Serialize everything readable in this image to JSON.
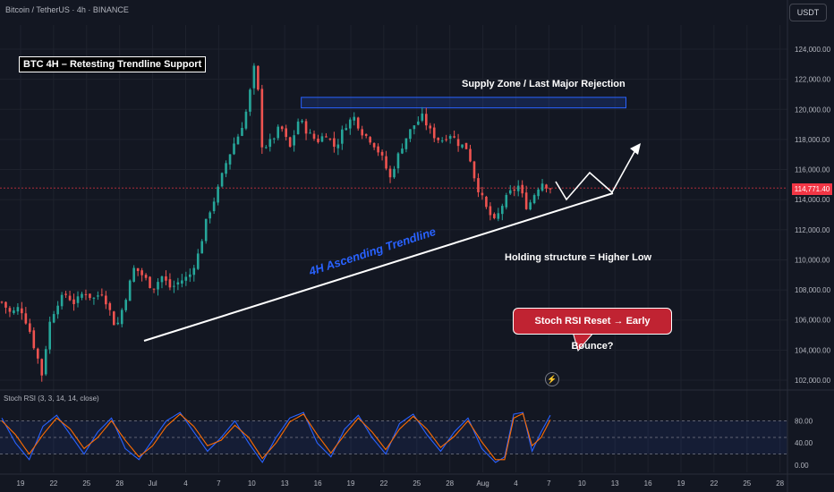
{
  "header": {
    "symbol": "Bitcoin / TetherUS · 4h · BINANCE",
    "currency": "USDT"
  },
  "annotations": {
    "title": "BTC 4H – Retesting Trendline Support",
    "supply_zone": "Supply Zone / Last Major Rejection",
    "trendline": "4H Ascending Trendline",
    "structure": "Holding structure = Higher Low",
    "callout": "Stoch RSI Reset → Early Bounce?"
  },
  "indicator": {
    "label": "Stoch RSI (3, 3, 14, 14, close)"
  },
  "icons": {
    "bolt": "lightning-icon"
  },
  "colors": {
    "background": "#131722",
    "up": "#26a69a",
    "down": "#ef5350",
    "k_line": "#2962ff",
    "d_line": "#ff6d00",
    "zone": "#2962ff",
    "price_line": "#f23645"
  },
  "chart_data": [
    {
      "type": "candlestick",
      "price_axis": {
        "ylim": [
          101000,
          125000
        ],
        "ticks": [
          "124,000.00",
          "122,000.00",
          "120,000.00",
          "118,000.00",
          "116,000.00",
          "114,000.00",
          "112,000.00",
          "110,000.00",
          "108,000.00",
          "106,000.00",
          "104,000.00",
          "102,000.00"
        ]
      },
      "last_price": "114,771.40",
      "last_price_value": 114771.4,
      "x_ticks": [
        "19",
        "22",
        "25",
        "28",
        "Jul",
        "4",
        "7",
        "10",
        "13",
        "16",
        "19",
        "22",
        "25",
        "28",
        "Aug",
        "4",
        "7",
        "10",
        "13",
        "16",
        "19",
        "22",
        "25",
        "28"
      ],
      "anchor_points": [
        [
          0,
          107200
        ],
        [
          2,
          106400
        ],
        [
          4,
          106900
        ],
        [
          6,
          105400
        ],
        [
          7,
          104300
        ],
        [
          8,
          103300
        ],
        [
          9,
          102100
        ],
        [
          10,
          105400
        ],
        [
          12,
          107100
        ],
        [
          14,
          107700
        ],
        [
          16,
          107100
        ],
        [
          18,
          107900
        ],
        [
          20,
          107400
        ],
        [
          22,
          107900
        ],
        [
          24,
          106300
        ],
        [
          25,
          105400
        ],
        [
          27,
          107400
        ],
        [
          29,
          109500
        ],
        [
          31,
          108900
        ],
        [
          33,
          108100
        ],
        [
          35,
          108900
        ],
        [
          37,
          108100
        ],
        [
          39,
          108600
        ],
        [
          41,
          108900
        ],
        [
          43,
          110400
        ],
        [
          45,
          112900
        ],
        [
          47,
          114400
        ],
        [
          49,
          116400
        ],
        [
          51,
          117900
        ],
        [
          52,
          118400
        ],
        [
          53,
          119400
        ],
        [
          54,
          120400
        ],
        [
          55,
          123000
        ],
        [
          56,
          121400
        ],
        [
          57,
          117400
        ],
        [
          59,
          117900
        ],
        [
          61,
          118900
        ],
        [
          63,
          117400
        ],
        [
          65,
          119400
        ],
        [
          67,
          118400
        ],
        [
          69,
          117900
        ],
        [
          71,
          118400
        ],
        [
          73,
          117400
        ],
        [
          75,
          118900
        ],
        [
          77,
          119500
        ],
        [
          79,
          118400
        ],
        [
          81,
          117900
        ],
        [
          83,
          116900
        ],
        [
          85,
          115400
        ],
        [
          86,
          116400
        ],
        [
          88,
          117900
        ],
        [
          90,
          118900
        ],
        [
          92,
          119500
        ],
        [
          94,
          118400
        ],
        [
          96,
          117900
        ],
        [
          98,
          118400
        ],
        [
          100,
          117700
        ],
        [
          102,
          117400
        ],
        [
          103,
          115900
        ],
        [
          104,
          114900
        ],
        [
          106,
          113400
        ],
        [
          108,
          112400
        ],
        [
          109,
          113400
        ],
        [
          111,
          114400
        ],
        [
          113,
          114900
        ],
        [
          115,
          113400
        ],
        [
          116,
          114100
        ],
        [
          118,
          115200
        ],
        [
          120,
          114771
        ]
      ],
      "trendline": {
        "from": [
          "Jun 30",
          104600
        ],
        "to": [
          "Aug 13",
          114400
        ]
      },
      "supply_zone": {
        "from": [
          "Jul 14",
          120100
        ],
        "to": [
          "Aug 13",
          120800
        ]
      },
      "projection": [
        [
          115000,
          114000
        ],
        [
          115200,
          114300
        ],
        [
          117800,
          116500
        ]
      ]
    },
    {
      "type": "line",
      "name": "Stoch RSI",
      "ylim": [
        0,
        100
      ],
      "ticks": [
        "80.00",
        "40.00",
        "0.00"
      ],
      "bands": [
        20,
        50,
        80
      ],
      "series": [
        {
          "name": "K",
          "anchors": [
            [
              0,
              85
            ],
            [
              3,
              40
            ],
            [
              6,
              10
            ],
            [
              9,
              70
            ],
            [
              12,
              90
            ],
            [
              15,
              55
            ],
            [
              18,
              20
            ],
            [
              21,
              60
            ],
            [
              24,
              85
            ],
            [
              27,
              30
            ],
            [
              30,
              10
            ],
            [
              33,
              45
            ],
            [
              36,
              80
            ],
            [
              39,
              95
            ],
            [
              42,
              60
            ],
            [
              45,
              25
            ],
            [
              48,
              50
            ],
            [
              51,
              80
            ],
            [
              54,
              40
            ],
            [
              57,
              5
            ],
            [
              60,
              50
            ],
            [
              63,
              85
            ],
            [
              66,
              95
            ],
            [
              69,
              40
            ],
            [
              72,
              15
            ],
            [
              75,
              65
            ],
            [
              78,
              90
            ],
            [
              81,
              50
            ],
            [
              84,
              20
            ],
            [
              87,
              75
            ],
            [
              90,
              92
            ],
            [
              93,
              55
            ],
            [
              96,
              25
            ],
            [
              99,
              60
            ],
            [
              102,
              85
            ],
            [
              105,
              30
            ],
            [
              108,
              5
            ],
            [
              110,
              15
            ],
            [
              112,
              92
            ],
            [
              114,
              95
            ],
            [
              116,
              25
            ],
            [
              118,
              60
            ],
            [
              120,
              90
            ]
          ]
        },
        {
          "name": "D",
          "anchors": [
            [
              0,
              80
            ],
            [
              3,
              55
            ],
            [
              6,
              20
            ],
            [
              9,
              55
            ],
            [
              12,
              85
            ],
            [
              15,
              65
            ],
            [
              18,
              30
            ],
            [
              21,
              50
            ],
            [
              24,
              80
            ],
            [
              27,
              45
            ],
            [
              30,
              15
            ],
            [
              33,
              35
            ],
            [
              36,
              70
            ],
            [
              39,
              92
            ],
            [
              42,
              70
            ],
            [
              45,
              35
            ],
            [
              48,
              45
            ],
            [
              51,
              72
            ],
            [
              54,
              50
            ],
            [
              57,
              12
            ],
            [
              60,
              40
            ],
            [
              63,
              78
            ],
            [
              66,
              92
            ],
            [
              69,
              55
            ],
            [
              72,
              22
            ],
            [
              75,
              55
            ],
            [
              78,
              85
            ],
            [
              81,
              60
            ],
            [
              84,
              28
            ],
            [
              87,
              65
            ],
            [
              90,
              88
            ],
            [
              93,
              65
            ],
            [
              96,
              32
            ],
            [
              99,
              52
            ],
            [
              102,
              80
            ],
            [
              105,
              42
            ],
            [
              108,
              10
            ],
            [
              110,
              10
            ],
            [
              112,
              85
            ],
            [
              114,
              93
            ],
            [
              116,
              35
            ],
            [
              118,
              50
            ],
            [
              120,
              82
            ]
          ]
        }
      ]
    }
  ]
}
